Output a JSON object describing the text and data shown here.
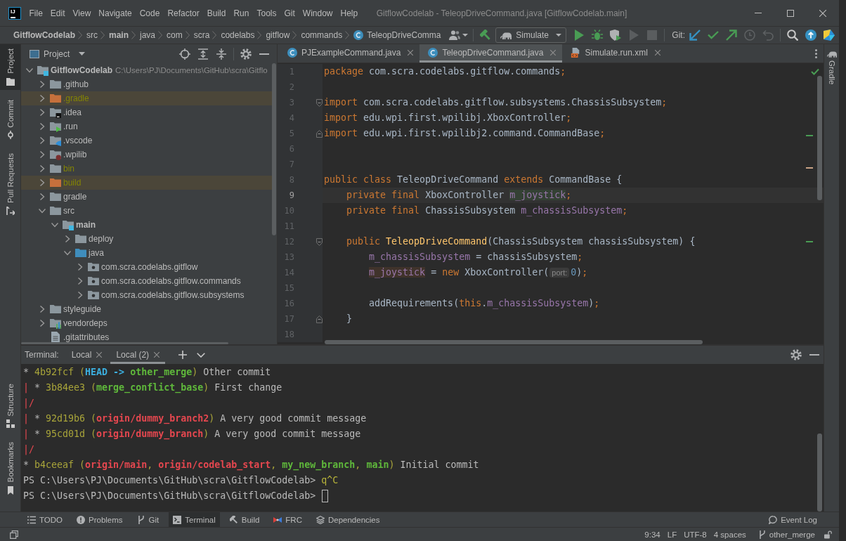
{
  "app_logo": "IJ",
  "menu": [
    {
      "label": "File"
    },
    {
      "label": "Edit"
    },
    {
      "label": "View"
    },
    {
      "label": "Navigate"
    },
    {
      "label": "Code"
    },
    {
      "label": "Refactor"
    },
    {
      "label": "Build"
    },
    {
      "label": "Run"
    },
    {
      "label": "Tools"
    },
    {
      "label": "Git"
    },
    {
      "label": "Window"
    },
    {
      "label": "Help"
    }
  ],
  "window": {
    "title": "GitflowCodelab - TeleopDriveCommand.java [GitflowCodelab.main]"
  },
  "breadcrumbs": [
    {
      "label": "GitflowCodelab",
      "kind": "module"
    },
    {
      "label": "src",
      "kind": "folder"
    },
    {
      "label": "main",
      "kind": "module"
    },
    {
      "label": "java",
      "kind": "folder"
    },
    {
      "label": "com",
      "kind": "folder"
    },
    {
      "label": "scra",
      "kind": "folder"
    },
    {
      "label": "codelabs",
      "kind": "folder"
    },
    {
      "label": "gitflow",
      "kind": "folder"
    },
    {
      "label": "commands",
      "kind": "folder"
    },
    {
      "label": "TeleopDriveComma",
      "kind": "class"
    }
  ],
  "run_configuration": "Simulate",
  "run_toolbar": [
    {
      "kind": "run",
      "disabled": false
    },
    {
      "kind": "debug",
      "disabled": false
    },
    {
      "kind": "coverage",
      "disabled": false
    },
    {
      "kind": "resume",
      "disabled": true
    },
    {
      "kind": "stop",
      "disabled": true
    }
  ],
  "vcs_toolbar_label": "Git:",
  "left_stripe": {
    "top": [
      {
        "label": "Project",
        "kind": "project",
        "selected": true
      },
      {
        "label": "Commit",
        "kind": "commit",
        "selected": false
      },
      {
        "label": "Pull Requests",
        "kind": "pull_requests",
        "selected": false
      }
    ],
    "bottom": [
      {
        "label": "Structure",
        "kind": "structure",
        "selected": false
      },
      {
        "label": "Bookmarks",
        "kind": "bookmarks",
        "selected": false
      }
    ]
  },
  "right_stripe": [
    {
      "label": "Gradle",
      "kind": "gradle",
      "selected": false
    }
  ],
  "project": {
    "view": "Project",
    "tree": [
      {
        "label": "GitflowCodelab",
        "path": "C:\\Users\\PJ\\Documents\\GitHub\\scra\\Gitflo",
        "kind": "module",
        "ignored": false,
        "excluded": false,
        "expanded": true,
        "children": [
          {
            "label": ".github",
            "kind": "folder",
            "ignored": false,
            "excluded": false,
            "expanded": false
          },
          {
            "label": ".gradle",
            "kind": "folder",
            "ignored": true,
            "excluded": true,
            "expanded": false
          },
          {
            "label": ".idea",
            "kind": "idea",
            "ignored": false,
            "excluded": false,
            "expanded": false
          },
          {
            "label": ".run",
            "kind": "run",
            "ignored": false,
            "excluded": false,
            "expanded": false
          },
          {
            "label": ".vscode",
            "kind": "vscode",
            "ignored": false,
            "excluded": false,
            "expanded": false
          },
          {
            "label": ".wpilib",
            "kind": "wpilib",
            "ignored": false,
            "excluded": false,
            "expanded": false
          },
          {
            "label": "bin",
            "kind": "folder",
            "ignored": true,
            "excluded": false,
            "expanded": false
          },
          {
            "label": "build",
            "kind": "folder",
            "ignored": true,
            "excluded": true,
            "expanded": false
          },
          {
            "label": "gradle",
            "kind": "folder",
            "ignored": false,
            "excluded": false,
            "expanded": false
          },
          {
            "label": "src",
            "kind": "folder",
            "ignored": false,
            "excluded": false,
            "expanded": true,
            "children": [
              {
                "label": "main",
                "kind": "module",
                "ignored": false,
                "excluded": false,
                "expanded": true,
                "children": [
                  {
                    "label": "deploy",
                    "kind": "folder",
                    "ignored": false,
                    "excluded": false,
                    "expanded": false
                  },
                  {
                    "label": "java",
                    "kind": "source",
                    "ignored": false,
                    "excluded": false,
                    "expanded": true,
                    "children": [
                      {
                        "label": "com.scra.codelabs.gitflow",
                        "kind": "package",
                        "ignored": false,
                        "excluded": false,
                        "expanded": false
                      },
                      {
                        "label": "com.scra.codelabs.gitflow.commands",
                        "kind": "package",
                        "ignored": false,
                        "excluded": false,
                        "expanded": false
                      },
                      {
                        "label": "com.scra.codelabs.gitflow.subsystems",
                        "kind": "package",
                        "ignored": false,
                        "excluded": false,
                        "expanded": false
                      }
                    ]
                  }
                ]
              }
            ]
          },
          {
            "label": "styleguide",
            "kind": "folder",
            "ignored": false,
            "excluded": false,
            "expanded": false
          },
          {
            "label": "vendordeps",
            "kind": "library",
            "ignored": false,
            "excluded": false,
            "expanded": false
          },
          {
            "label": ".gitattributes",
            "kind": "file",
            "ignored": false,
            "excluded": false
          }
        ]
      }
    ]
  },
  "editor": {
    "tabs": [
      {
        "label": "PJExampleCommand.java",
        "kind": "class",
        "selected": false
      },
      {
        "label": "TeleopDriveCommand.java",
        "kind": "class",
        "selected": true
      },
      {
        "label": "Simulate.run.xml",
        "kind": "xml",
        "selected": false
      }
    ],
    "lines": [
      {
        "number": "1",
        "kind": "plain",
        "current": false,
        "tokens": [
          {
            "kind": "keyword",
            "text": "package"
          },
          {
            "kind": "plain",
            "text": " com.scra.codelabs.gitflow.commands"
          },
          {
            "kind": "punct",
            "text": ";"
          }
        ]
      },
      {
        "number": "2",
        "kind": "plain",
        "current": false
      },
      {
        "number": "3",
        "kind": "opener",
        "current": false,
        "tokens": [
          {
            "kind": "keyword",
            "text": "import"
          },
          {
            "kind": "plain",
            "text": " com.scra.codelabs.gitflow.subsystems.ChassisSubsystem"
          },
          {
            "kind": "punct",
            "text": ";"
          }
        ]
      },
      {
        "number": "4",
        "kind": "plain",
        "current": false,
        "tokens": [
          {
            "kind": "keyword",
            "text": "import"
          },
          {
            "kind": "plain",
            "text": " edu.wpi.first.wpilibj.XboxController"
          },
          {
            "kind": "punct",
            "text": ";"
          }
        ]
      },
      {
        "number": "5",
        "kind": "closer",
        "current": false,
        "tokens": [
          {
            "kind": "keyword",
            "text": "import"
          },
          {
            "kind": "plain",
            "text": " edu.wpi.first.wpilibj2.command.CommandBase"
          },
          {
            "kind": "punct",
            "text": ";"
          }
        ]
      },
      {
        "number": "6",
        "kind": "plain",
        "current": false
      },
      {
        "number": "7",
        "kind": "plain",
        "current": false
      },
      {
        "number": "8",
        "kind": "plain",
        "current": false,
        "tokens": [
          {
            "kind": "keyword",
            "text": "public class"
          },
          {
            "kind": "plain",
            "text": " TeleopDriveCommand "
          },
          {
            "kind": "keyword",
            "text": "extends"
          },
          {
            "kind": "plain",
            "text": " CommandBase {"
          }
        ]
      },
      {
        "number": "9",
        "kind": "plain",
        "current": true,
        "tokens": [
          {
            "kind": "keyword",
            "text": "    private final"
          },
          {
            "kind": "plain",
            "text": " XboxController "
          },
          {
            "kind": "usage",
            "text": "m_joystick"
          },
          {
            "kind": "punct",
            "text": ";"
          }
        ]
      },
      {
        "number": "10",
        "kind": "plain",
        "current": false,
        "tokens": [
          {
            "kind": "keyword",
            "text": "    private final"
          },
          {
            "kind": "plain",
            "text": " ChassisSubsystem "
          },
          {
            "kind": "field",
            "text": "m_chassisSubsystem"
          },
          {
            "kind": "punct",
            "text": ";"
          }
        ]
      },
      {
        "number": "11",
        "kind": "plain",
        "current": false
      },
      {
        "number": "12",
        "kind": "opener",
        "current": false,
        "tokens": [
          {
            "kind": "keyword",
            "text": "    public "
          },
          {
            "kind": "decl",
            "text": "TeleopDriveCommand"
          },
          {
            "kind": "plain",
            "text": "(ChassisSubsystem chassisSubsystem) {"
          }
        ]
      },
      {
        "number": "13",
        "kind": "plain",
        "current": false,
        "tokens": [
          {
            "kind": "field",
            "text": "        m_chassisSubsystem"
          },
          {
            "kind": "plain",
            "text": " = chassisSubsystem"
          },
          {
            "kind": "punct",
            "text": ";"
          }
        ]
      },
      {
        "number": "14",
        "kind": "plain",
        "current": false,
        "tokens": [
          {
            "kind": "assignment",
            "text": "        m_joystick"
          },
          {
            "kind": "plain",
            "text": " = "
          },
          {
            "kind": "keyword",
            "text": "new"
          },
          {
            "kind": "plain",
            "text": " XboxController("
          },
          {
            "kind": "hint",
            "text": "port:"
          },
          {
            "kind": "number",
            "text": "0"
          },
          {
            "kind": "plain",
            "text": ")"
          },
          {
            "kind": "punct",
            "text": ";"
          }
        ]
      },
      {
        "number": "15",
        "kind": "plain",
        "current": false
      },
      {
        "number": "16",
        "kind": "plain",
        "current": false,
        "tokens": [
          {
            "kind": "plain",
            "text": "        addRequirements("
          },
          {
            "kind": "keyword",
            "text": "this"
          },
          {
            "kind": "plain",
            "text": "."
          },
          {
            "kind": "field",
            "text": "m_chassisSubsystem"
          },
          {
            "kind": "plain",
            "text": ")"
          },
          {
            "kind": "punct",
            "text": ";"
          }
        ]
      },
      {
        "number": "17",
        "kind": "closer",
        "current": false,
        "tokens": [
          {
            "kind": "plain",
            "text": "    }"
          }
        ]
      },
      {
        "number": "18",
        "kind": "plain",
        "current": false
      }
    ]
  },
  "terminal": {
    "title": "Terminal:",
    "tabs": [
      {
        "label": "Local",
        "selected": false
      },
      {
        "label": "Local (2)",
        "selected": true
      }
    ],
    "lines": [
      {
        "cursor": false,
        "segments": [
          {
            "kind": "text",
            "text": "* "
          },
          {
            "kind": "commit",
            "text": "4b92fcf ("
          },
          {
            "kind": "head",
            "text": "HEAD -> "
          },
          {
            "kind": "local",
            "text": "other_merge"
          },
          {
            "kind": "commit",
            "text": ")"
          },
          {
            "kind": "text",
            "text": " Other commit"
          }
        ]
      },
      {
        "cursor": false,
        "segments": [
          {
            "kind": "graph",
            "text": "| "
          },
          {
            "kind": "text",
            "text": "* "
          },
          {
            "kind": "commit",
            "text": "3b84ee3 ("
          },
          {
            "kind": "local",
            "text": "merge_conflict_base"
          },
          {
            "kind": "commit",
            "text": ")"
          },
          {
            "kind": "text",
            "text": " First change"
          }
        ]
      },
      {
        "cursor": false,
        "segments": [
          {
            "kind": "graph",
            "text": "|/"
          }
        ]
      },
      {
        "cursor": false,
        "segments": [
          {
            "kind": "graph",
            "text": "| "
          },
          {
            "kind": "text",
            "text": "* "
          },
          {
            "kind": "commit",
            "text": "92d19b6 ("
          },
          {
            "kind": "remote",
            "text": "origin/dummy_branch2"
          },
          {
            "kind": "commit",
            "text": ")"
          },
          {
            "kind": "text",
            "text": " A very good commit message"
          }
        ]
      },
      {
        "cursor": false,
        "segments": [
          {
            "kind": "graph",
            "text": "| "
          },
          {
            "kind": "text",
            "text": "* "
          },
          {
            "kind": "commit",
            "text": "95cd01d ("
          },
          {
            "kind": "remote",
            "text": "origin/dummy_branch"
          },
          {
            "kind": "commit",
            "text": ")"
          },
          {
            "kind": "text",
            "text": " A very good commit message"
          }
        ]
      },
      {
        "cursor": false,
        "segments": [
          {
            "kind": "graph",
            "text": "|/"
          }
        ]
      },
      {
        "cursor": false,
        "segments": [
          {
            "kind": "text",
            "text": "* "
          },
          {
            "kind": "commit",
            "text": "b4ceeaf ("
          },
          {
            "kind": "remote",
            "text": "origin/main"
          },
          {
            "kind": "commit",
            "text": ", "
          },
          {
            "kind": "remote",
            "text": "origin/codelab_start"
          },
          {
            "kind": "commit",
            "text": ", "
          },
          {
            "kind": "local",
            "text": "my_new_branch"
          },
          {
            "kind": "commit",
            "text": ", "
          },
          {
            "kind": "local",
            "text": "main"
          },
          {
            "kind": "commit",
            "text": ")"
          },
          {
            "kind": "text",
            "text": " Initial commit"
          }
        ]
      },
      {
        "cursor": false,
        "segments": [
          {
            "kind": "text",
            "text": "PS C:\\Users\\PJ\\Documents\\GitHub\\scra\\GitflowCodelab> "
          },
          {
            "kind": "input",
            "text": "q^C"
          }
        ]
      },
      {
        "cursor": true,
        "segments": [
          {
            "kind": "text",
            "text": "PS C:\\Users\\PJ\\Documents\\GitHub\\scra\\GitflowCodelab>"
          }
        ]
      }
    ]
  },
  "tool_windows": [
    {
      "label": "TODO",
      "kind": "todo",
      "selected": false
    },
    {
      "label": "Problems",
      "kind": "problems",
      "selected": false
    },
    {
      "label": "Git",
      "kind": "git",
      "selected": false
    },
    {
      "label": "Terminal",
      "kind": "terminal",
      "selected": true
    },
    {
      "label": "Build",
      "kind": "build",
      "selected": false
    },
    {
      "label": "FRC",
      "kind": "frc",
      "selected": false
    },
    {
      "label": "Dependencies",
      "kind": "dependencies",
      "selected": false
    }
  ],
  "event_log": "Event Log",
  "status_bar": {
    "items": [
      "9:34",
      "LF",
      "UTF-8",
      "4 spaces"
    ],
    "branch": "other_merge"
  }
}
